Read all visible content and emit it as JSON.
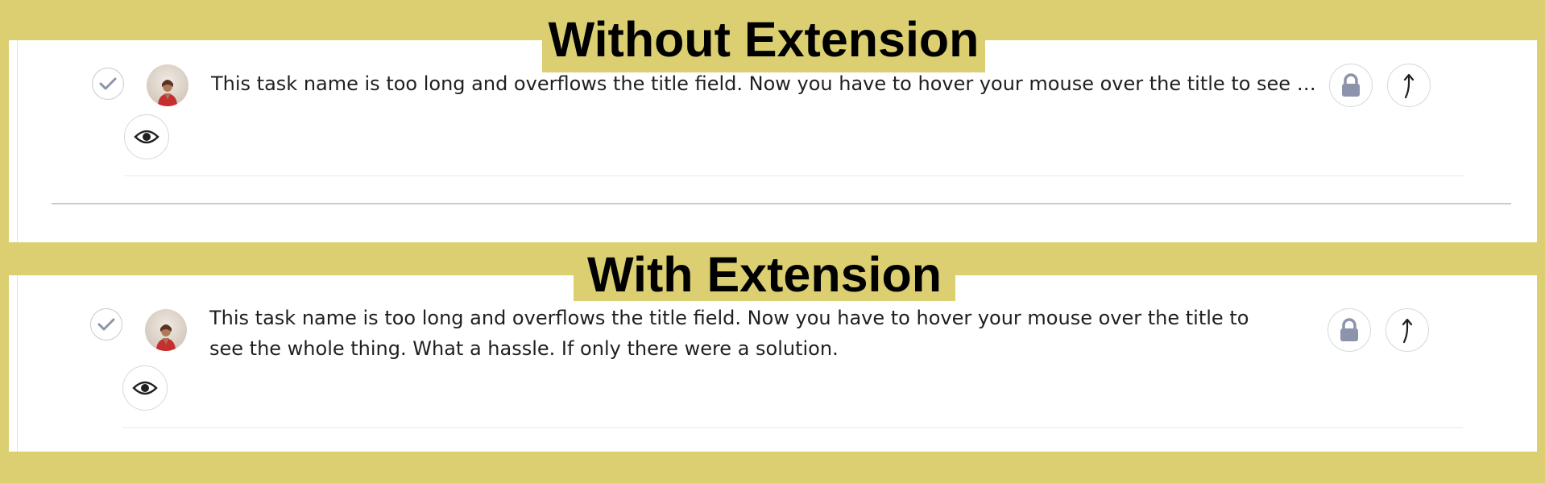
{
  "banners": {
    "top": "Without Extension",
    "bottom": "With Extension"
  },
  "task": {
    "title_without_extension": "This task name is too long and overflows the title field. Now you have to hover your mouse over the title to see the whole thing. What a hassle. If only there were a solution.",
    "title_with_extension": "This task name is too long and overflows the title field. Now you have to hover your mouse over the title to see the whole thing. What a hassle. If only there were a solution."
  },
  "icons": {
    "complete": "check-icon",
    "avatar": "user-avatar",
    "lock": "lock-icon",
    "upload": "upload-arrow-icon",
    "follow": "eye-icon"
  },
  "colors": {
    "background": "#dbcf72",
    "panel": "#ffffff",
    "icon_gray": "#8b94ab",
    "text": "#1e1f21"
  }
}
